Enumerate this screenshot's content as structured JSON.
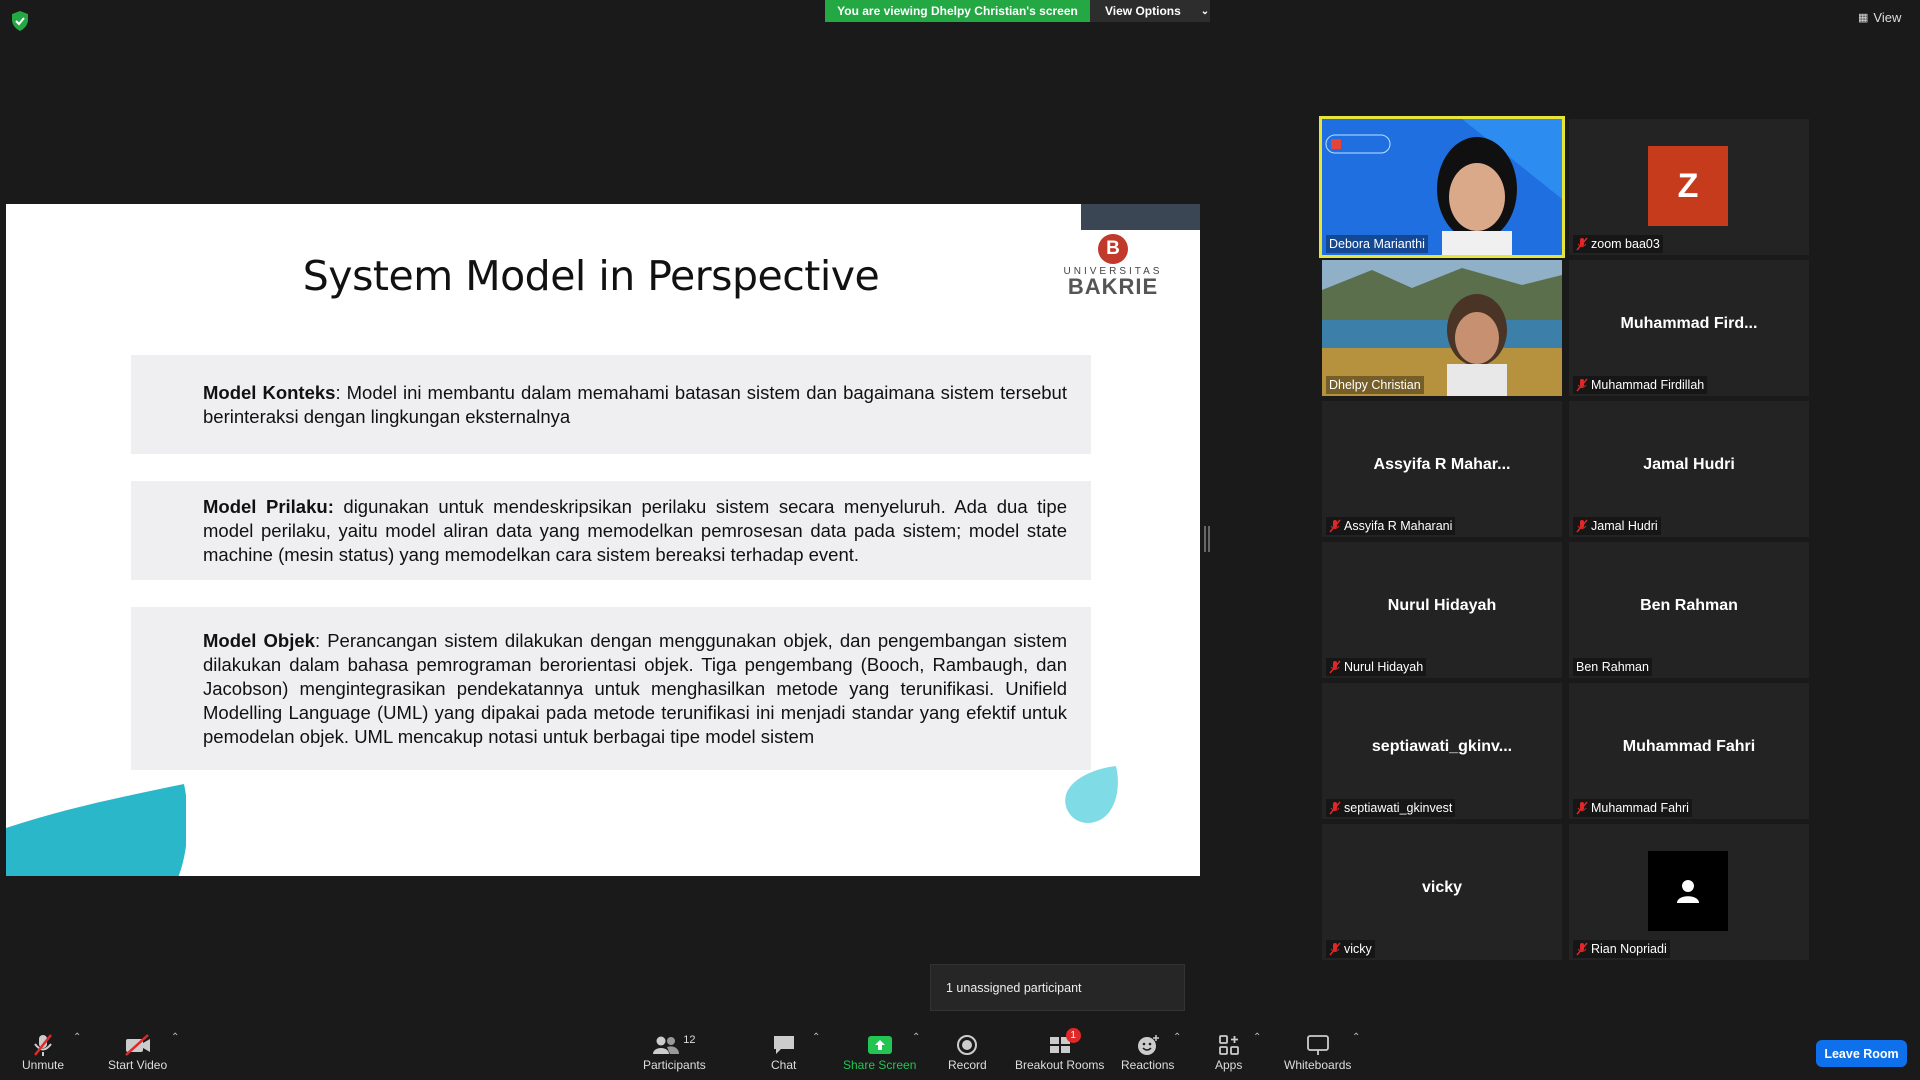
{
  "top_bar": {
    "viewing_banner": "You are viewing Dhelpy Christian's screen",
    "view_options": "View Options",
    "view_button": "View"
  },
  "slide": {
    "title": "System Model in Perspective",
    "logo_top": "UNIVERSITAS",
    "logo_main": "BAKRIE",
    "logo_letter": "B",
    "boxes": [
      {
        "term": "Model Konteks",
        "text": ": Model ini membantu dalam memahami batasan sistem dan bagaimana sistem tersebut berinteraksi dengan lingkungan eksternalnya"
      },
      {
        "term": "Model Prilaku:",
        "text": " digunakan untuk mendeskripsikan perilaku sistem secara menyeluruh. Ada dua tipe model perilaku, yaitu model aliran data yang memodelkan pemrosesan data pada sistem; model state machine (mesin status) yang memodelkan cara sistem bereaksi terhadap event."
      },
      {
        "term": "Model Objek",
        "text": ": Perancangan sistem dilakukan dengan menggunakan objek, dan pengembangan sistem dilakukan dalam bahasa pemrograman berorientasi objek. Tiga pengembang (Booch, Rambaugh, dan Jacobson) mengintegrasikan pendekatannya untuk menghasilkan metode yang terunifikasi. Unifield Modelling Language (UML) yang dipakai pada metode terunifikasi ini menjadi standar yang efektif untuk pemodelan objek. UML mencakup notasi untuk berbagai tipe model sistem"
      }
    ]
  },
  "participants": [
    {
      "label": "Debora Marianthi",
      "center": "",
      "muted": false
    },
    {
      "label": "zoom baa03",
      "center": "",
      "avatar": "Z",
      "muted": true
    },
    {
      "label": "Dhelpy Christian",
      "center": "",
      "muted": false
    },
    {
      "label": "Muhammad Firdillah",
      "center": "Muhammad  Fird...",
      "muted": true
    },
    {
      "label": "Assyifa R Maharani",
      "center": "Assyifa  R  Mahar...",
      "muted": true
    },
    {
      "label": "Jamal Hudri",
      "center": "Jamal Hudri",
      "muted": true
    },
    {
      "label": "Nurul Hidayah",
      "center": "Nurul Hidayah",
      "muted": true
    },
    {
      "label": "Ben Rahman",
      "center": "Ben Rahman",
      "muted": false
    },
    {
      "label": "septiawati_gkinvest",
      "center": "septiawati_gkinv...",
      "muted": true
    },
    {
      "label": "Muhammad Fahri",
      "center": "Muhammad Fahri",
      "muted": true
    },
    {
      "label": "vicky",
      "center": "vicky",
      "muted": true
    },
    {
      "label": "Rian Nopriadi",
      "center": "",
      "muted": true
    }
  ],
  "tooltip": "1 unassigned participant",
  "toolbar": {
    "unmute": "Unmute",
    "start_video": "Start Video",
    "participants": "Participants",
    "participants_count": "12",
    "chat": "Chat",
    "share_screen": "Share Screen",
    "record": "Record",
    "breakout_rooms": "Breakout Rooms",
    "breakout_badge": "1",
    "reactions": "Reactions",
    "apps": "Apps",
    "whiteboards": "Whiteboards",
    "leave_room": "Leave Room"
  },
  "colors": {
    "share_green": "#23a844",
    "active_speaker": "#e7e43a",
    "leave_blue": "#0e71eb",
    "muted_red": "#e02828",
    "slide_teal": "#29b7c9"
  }
}
